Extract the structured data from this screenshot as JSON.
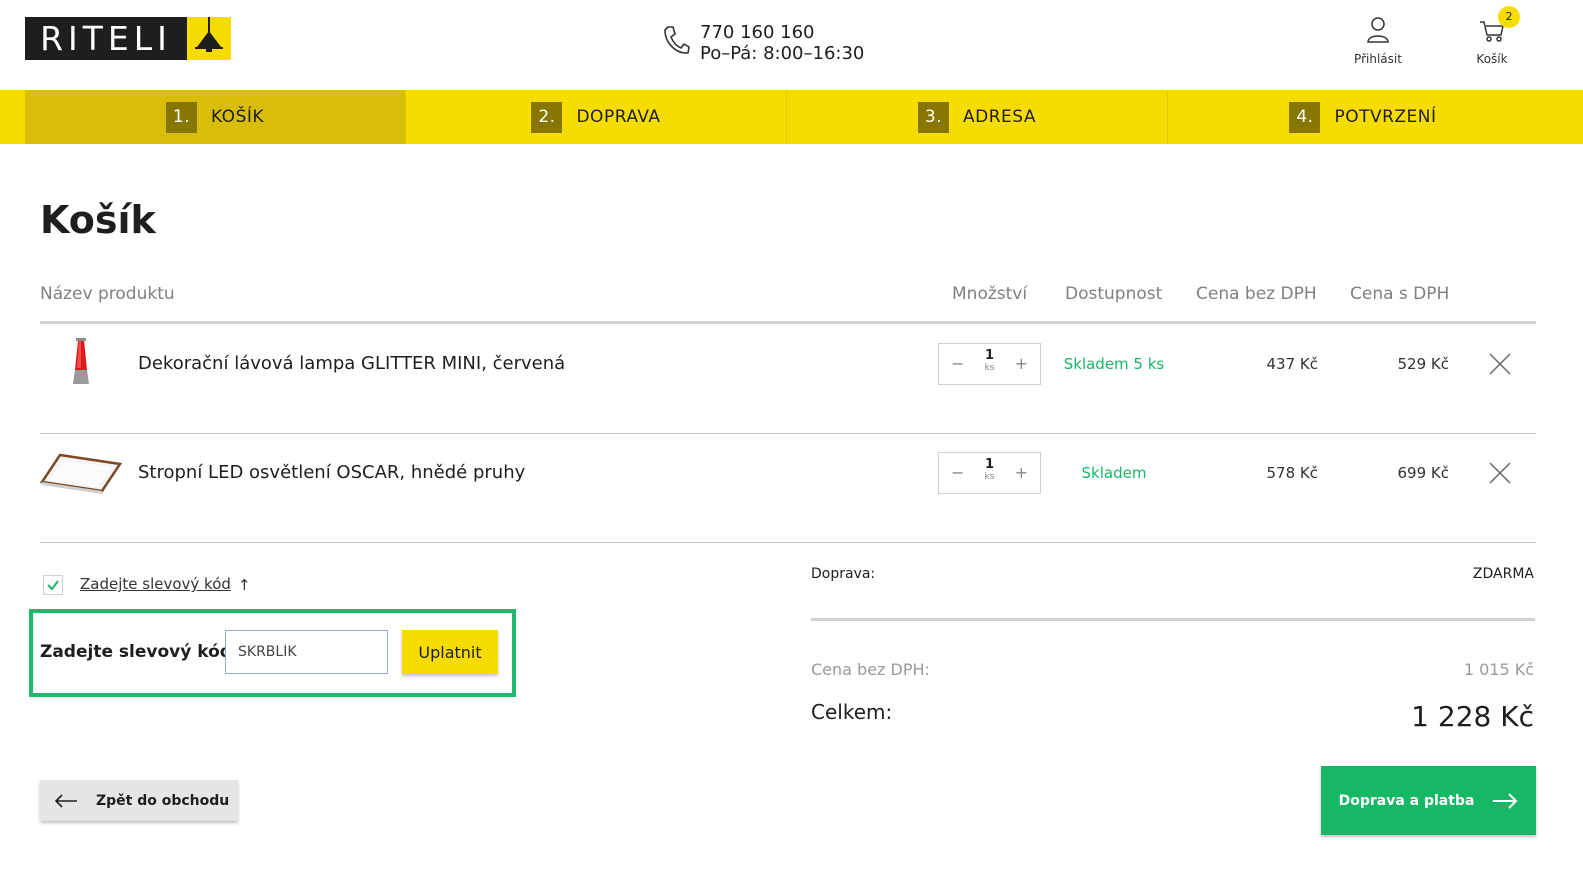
{
  "header": {
    "logo_text": "RITELI",
    "phone_number": "770 160 160",
    "phone_hours": "Po–Pá: 8:00–16:30",
    "login_label": "Přihlásit",
    "cart_label": "Košík",
    "cart_count": "2",
    "brand_color": "#f7dc00"
  },
  "steps": [
    {
      "num": "1.",
      "label": "KOŠÍK"
    },
    {
      "num": "2.",
      "label": "DOPRAVA"
    },
    {
      "num": "3.",
      "label": "ADRESA"
    },
    {
      "num": "4.",
      "label": "POTVRZENÍ"
    }
  ],
  "page_title": "Košík",
  "table": {
    "columns": {
      "name": "Název produktu",
      "qty": "Množství",
      "availability": "Dostupnost",
      "price_ex": "Cena bez DPH",
      "price_inc": "Cena s DPH"
    },
    "rows": [
      {
        "name": "Dekorační lávová lampa GLITTER MINI, červená",
        "qty": "1",
        "unit": "ks",
        "availability": "Skladem 5 ks",
        "price_ex": "437 Kč",
        "price_inc": "529 Kč"
      },
      {
        "name": "Stropní LED osvětlení OSCAR, hnědé pruhy",
        "qty": "1",
        "unit": "ks",
        "availability": "Skladem",
        "price_ex": "578 Kč",
        "price_inc": "699 Kč"
      }
    ]
  },
  "discount": {
    "toggle_label": "Zadejte slevový kód",
    "arrow": "↑",
    "field_label": "Zadejte slevový kód",
    "input_value": "SKRBLÍK",
    "apply_label": "Uplatnit"
  },
  "summary": {
    "shipping_label": "Doprava:",
    "shipping_value": "ZDARMA",
    "price_ex_label": "Cena bez DPH:",
    "price_ex_value": "1 015 Kč",
    "total_label": "Celkem:",
    "total_value": "1 228 Kč"
  },
  "buttons": {
    "back_label": "Zpět do obchodu",
    "next_label": "Doprava a platba"
  }
}
